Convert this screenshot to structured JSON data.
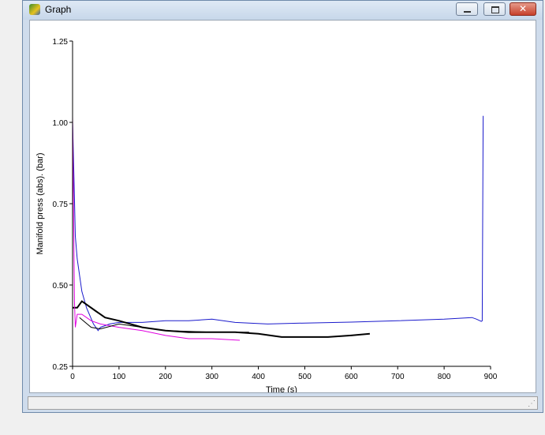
{
  "window": {
    "title": "Graph",
    "close_glyph": "✕",
    "grip_glyph": "⋰"
  },
  "colors": {
    "series1": "#1a1acc",
    "series2": "#000000",
    "series3": "#e000e0"
  },
  "chart_data": {
    "type": "line",
    "xlabel": "Time (s)",
    "ylabel": "Manifold press (abs).  (bar)",
    "xlim": [
      0,
      900
    ],
    "ylim": [
      0.25,
      1.25
    ],
    "xticks": [
      0,
      100,
      200,
      300,
      400,
      500,
      600,
      700,
      800,
      900
    ],
    "yticks": [
      0.25,
      0.5,
      0.75,
      1.0,
      1.25
    ],
    "ytick_labels": [
      "0.25",
      "0.50",
      "0.75",
      "1.00",
      "1.25"
    ],
    "grid": false,
    "series": [
      {
        "color": "#1a1acc",
        "x": [
          0,
          3,
          6,
          10,
          20,
          30,
          45,
          55,
          60,
          80,
          100,
          150,
          200,
          250,
          300,
          350,
          420,
          500,
          600,
          700,
          800,
          860,
          870,
          880,
          882,
          884
        ],
        "y": [
          1.0,
          0.83,
          0.65,
          0.58,
          0.48,
          0.43,
          0.38,
          0.36,
          0.37,
          0.38,
          0.385,
          0.385,
          0.39,
          0.39,
          0.395,
          0.385,
          0.38,
          0.383,
          0.386,
          0.39,
          0.395,
          0.4,
          0.395,
          0.388,
          0.39,
          1.02
        ]
      },
      {
        "color": "#000000",
        "x": [
          0,
          5,
          10,
          20,
          30,
          50,
          70,
          100,
          150,
          200,
          250,
          300,
          350,
          400,
          450,
          500,
          550,
          600,
          640
        ],
        "y": [
          0.43,
          0.43,
          0.43,
          0.45,
          0.44,
          0.42,
          0.4,
          0.39,
          0.37,
          0.36,
          0.355,
          0.355,
          0.355,
          0.35,
          0.34,
          0.34,
          0.34,
          0.345,
          0.35
        ]
      },
      {
        "color": "#e000e0",
        "x": [
          0,
          2,
          4,
          6,
          10,
          20,
          30,
          40,
          60,
          80,
          100,
          150,
          200,
          250,
          300,
          360
        ],
        "y": [
          1.02,
          0.75,
          0.45,
          0.37,
          0.41,
          0.41,
          0.4,
          0.39,
          0.38,
          0.375,
          0.37,
          0.36,
          0.345,
          0.335,
          0.335,
          0.33
        ]
      },
      {
        "color": "#000000",
        "x": [
          15,
          40,
          60,
          100,
          150,
          200,
          300,
          380
        ],
        "y": [
          0.4,
          0.37,
          0.365,
          0.38,
          0.37,
          0.36,
          0.355,
          0.355
        ]
      }
    ]
  }
}
